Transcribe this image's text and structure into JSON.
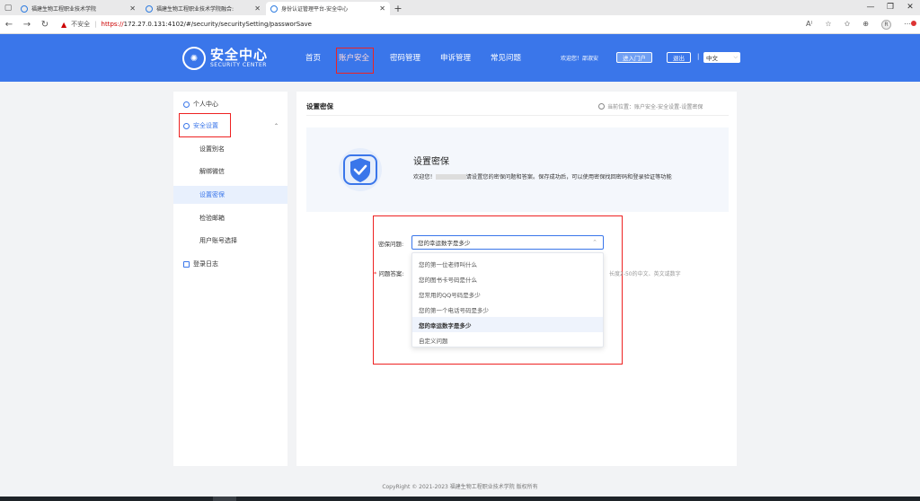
{
  "browser": {
    "tabs": [
      {
        "title": "福建生物工程职业技术学院",
        "active": false
      },
      {
        "title": "福建生物工程职业技术学院融合:",
        "active": false
      },
      {
        "title": "身份认证管理平台-安全中心",
        "active": true
      }
    ],
    "new_tab": "+",
    "insecure_label": "不安全",
    "url_scheme": "https://",
    "url_rest": "172.27.0.131:4102/#/security/securitySetting/passworSave"
  },
  "header": {
    "logo_main": "安全中心",
    "logo_sub": "SECURITY CENTER",
    "nav": [
      "首页",
      "账户安全",
      "密码管理",
      "申诉管理",
      "常见问题"
    ],
    "welcome": "欢迎您！邵淑安",
    "portal_button": "进入门户",
    "logout_button": "退出",
    "separator": "|",
    "language": "中文"
  },
  "sidebar": {
    "personal_center": "个人中心",
    "security_settings": "安全设置",
    "sub_items": [
      "设置别名",
      "解绑微信",
      "设置密保",
      "检验邮箱",
      "用户账号选择"
    ],
    "active_sub_index": 2,
    "login_log": "登录日志"
  },
  "main": {
    "title": "设置密保",
    "breadcrumb": "当前位置：账户安全-安全设置-设置密保",
    "banner_title": "设置密保",
    "banner_prefix": "欢迎您！",
    "banner_desc": "请设置您的密保问题和答案。保存成功后，可以使用密保找回密码和登录验证等功能"
  },
  "form": {
    "question_label": "密保问题:",
    "question_value": "您的幸运数字是多少",
    "answer_label": "问题答案:",
    "answer_required": "*",
    "hint": "长度2-50的中文、英文或数字",
    "options": [
      "您的第一位老师叫什么",
      "您的图书卡号码是什么",
      "您常用的QQ号码是多少",
      "您的第一个电话号码是多少",
      "您的幸运数字是多少",
      "自定义问题"
    ],
    "selected_index": 4
  },
  "footer": {
    "copyright": "CopyRight © 2021-2023 福建生物工程职业技术学院 版权所有"
  },
  "colors": {
    "primary": "#3a76ea",
    "annotation_red": "#e22",
    "page_bg": "#f2f3f5"
  }
}
